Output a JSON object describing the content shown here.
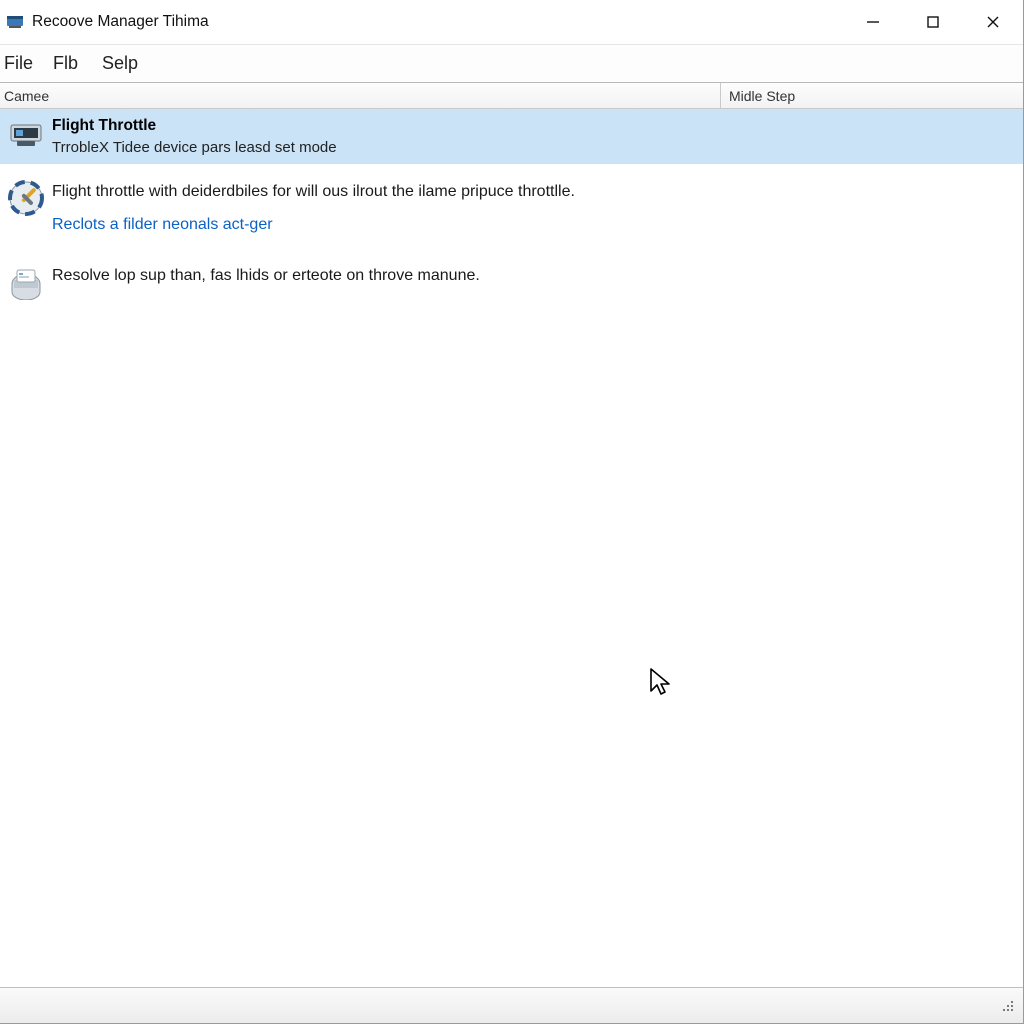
{
  "titlebar": {
    "title": "Recoove Manager Tihima"
  },
  "menu": {
    "file": "File",
    "flb": "Flb",
    "selp": "Selp"
  },
  "columns": {
    "name": "Camee",
    "step": "Midle Step"
  },
  "rows": {
    "selected": {
      "title": "Flight Throttle",
      "sub": "TrrobleX Tidee device pars leasd set mode"
    },
    "trouble": {
      "text": "Flight throttle with deiderdbiles for will ous ilrout the ilame pripuce throttlle.",
      "link": "Reclots a filder neonals act-ger"
    },
    "resolve": {
      "text": "Resolve lop sup than, fas lhids or erteote on throve manune."
    }
  }
}
